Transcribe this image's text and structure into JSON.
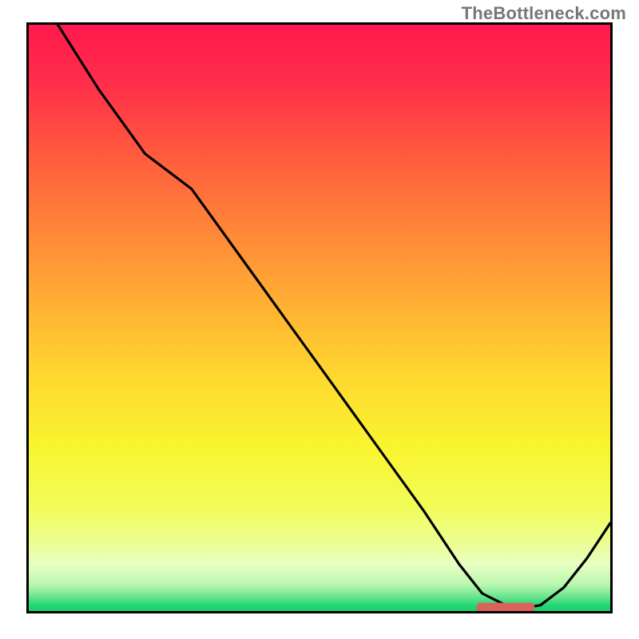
{
  "watermark": "TheBottleneck.com",
  "chart_data": {
    "type": "line",
    "title": "",
    "xlabel": "",
    "ylabel": "",
    "xlim": [
      0,
      100
    ],
    "ylim": [
      0,
      100
    ],
    "series": [
      {
        "name": "curve",
        "x": [
          5,
          12,
          20,
          28,
          36,
          44,
          52,
          60,
          68,
          74,
          78,
          82,
          85,
          88,
          92,
          96,
          100
        ],
        "y": [
          100,
          89,
          78,
          72,
          61,
          50,
          39,
          28,
          17,
          8,
          3,
          1,
          0.5,
          1,
          4,
          9,
          15
        ]
      }
    ],
    "marker": {
      "name": "highlight-bar",
      "x_start": 77,
      "x_end": 87,
      "y": 0.6,
      "color": "#d9635a"
    },
    "background_gradient_stops": [
      {
        "pos": 0.0,
        "color": "#ff1a4d"
      },
      {
        "pos": 0.1,
        "color": "#ff2e4a"
      },
      {
        "pos": 0.22,
        "color": "#ff5a3e"
      },
      {
        "pos": 0.35,
        "color": "#ff8638"
      },
      {
        "pos": 0.48,
        "color": "#ffb133"
      },
      {
        "pos": 0.6,
        "color": "#ffd82f"
      },
      {
        "pos": 0.72,
        "color": "#f9f52f"
      },
      {
        "pos": 0.82,
        "color": "#f2fd57"
      },
      {
        "pos": 0.88,
        "color": "#ecfe8f"
      },
      {
        "pos": 0.92,
        "color": "#e8ffc2"
      },
      {
        "pos": 0.955,
        "color": "#b9f7b0"
      },
      {
        "pos": 0.975,
        "color": "#6de58f"
      },
      {
        "pos": 0.99,
        "color": "#24d776"
      },
      {
        "pos": 1.0,
        "color": "#17cf6e"
      }
    ]
  }
}
